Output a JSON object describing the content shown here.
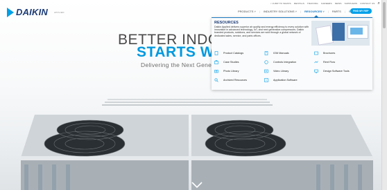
{
  "utility_links": [
    "< Jump to Siesta",
    "Rentals",
    "Training",
    "Careers",
    "News",
    "Suppliers",
    "Contact Us"
  ],
  "brand": {
    "name": "DAIKIN",
    "sub": "APPLIED"
  },
  "nav": {
    "items": [
      {
        "label": "Products ˅"
      },
      {
        "label": "Industry Solutions ˅"
      },
      {
        "label": "Resources ˅"
      },
      {
        "label": "Parts"
      },
      {
        "label": "Service"
      }
    ],
    "cta": "Find my rep"
  },
  "hero": {
    "line1": "BETTER INDOOR A",
    "line2": "STARTS WITH",
    "line3": "Delivering the Next Genera"
  },
  "mega": {
    "title": "RESOURCES",
    "description": "Daikin Applied delivers superior air quality and energy efficiency to every solution with innovation in advanced technology, IoT, and next generation compressors. Daikin branded products, solutions, and services are sold through a global network of dedicated sales, service, and parts offices.",
    "links": [
      {
        "label": "Product Catalogs",
        "icon": "catalog-icon"
      },
      {
        "label": "IOM Manuals",
        "icon": "manual-icon"
      },
      {
        "label": "Brochures",
        "icon": "brochure-icon"
      },
      {
        "label": "Case Studies",
        "icon": "case-study-icon"
      },
      {
        "label": "Controls Integration",
        "icon": "controls-icon"
      },
      {
        "label": "Rent Flow",
        "icon": "rent-icon"
      },
      {
        "label": "Photo Library",
        "icon": "photo-icon"
      },
      {
        "label": "Video Library",
        "icon": "video-icon"
      },
      {
        "label": "Design Software Tools",
        "icon": "software-icon"
      },
      {
        "label": "Archived Resources",
        "icon": "archive-icon"
      },
      {
        "label": "Application Software",
        "icon": "application-icon"
      }
    ]
  },
  "colors": {
    "brand_blue": "#00a0e9",
    "brand_navy": "#1c3b76",
    "accent": "#0099df"
  }
}
